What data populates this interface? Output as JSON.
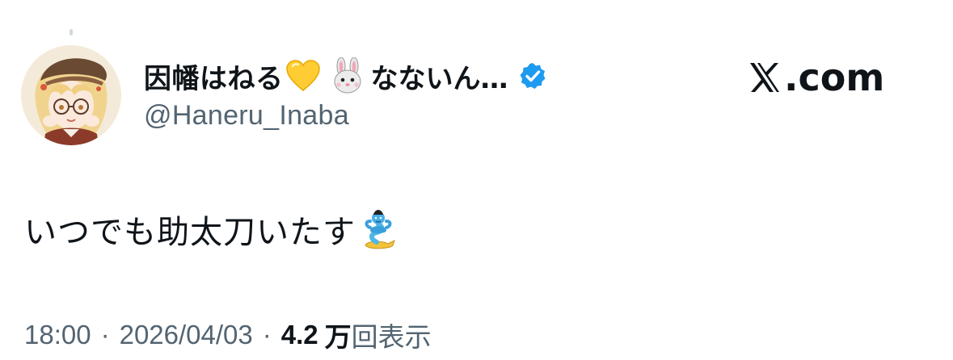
{
  "tweet": {
    "author": {
      "display_name": "因幡はねる",
      "name_emoji_1": "heart-emoji-yellow",
      "name_emoji_2": "rabbit-face-emoji",
      "display_name_tail": "なないん…",
      "handle": "@Haneru_Inaba",
      "verified": true,
      "verified_color": "#1d9bf0"
    },
    "brand": {
      "text": ".com",
      "logo": "x-logo"
    },
    "text": "いつでも助太刀いたす",
    "text_emoji": "genie-emoji",
    "meta": {
      "time": "18:00",
      "separator": "·",
      "date": "2026/04/03",
      "views_count": "4.2",
      "views_unit": "万",
      "views_label": "回表示"
    }
  },
  "colors": {
    "text_primary": "#0f1419",
    "text_secondary": "#536471",
    "accent": "#1d9bf0",
    "background": "#ffffff"
  }
}
